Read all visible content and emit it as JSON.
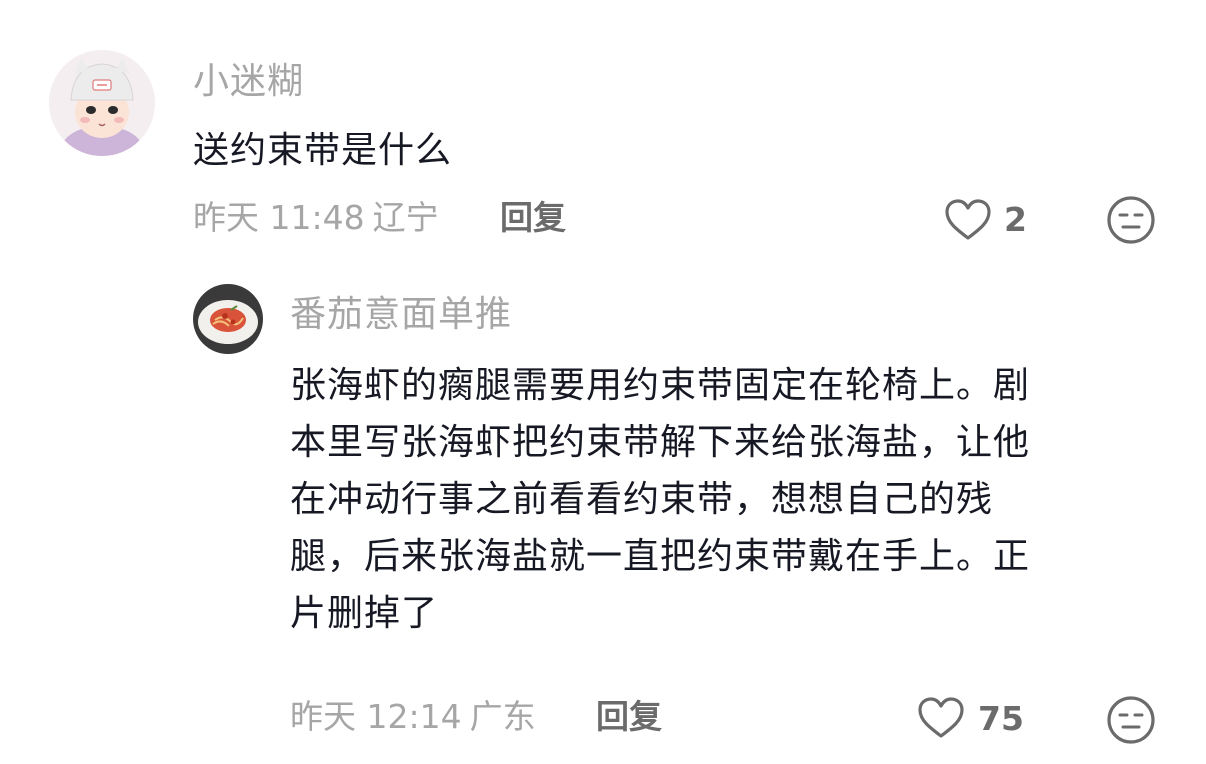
{
  "comments": [
    {
      "username": "小迷糊",
      "text": "送约束带是什么",
      "time": "昨天 11:48",
      "location": "辽宁",
      "reply_label": "回复",
      "likes": "2",
      "like_icon": "heart-outline-icon",
      "dislike_icon": "meh-face-icon"
    },
    {
      "username": "番茄意面单推",
      "text_lines": [
        "张海虾的瘸腿需要用约束带固定在轮椅上。剧",
        "本里写张海虾把约束带解下来给张海盐，让他",
        "在冲动行事之前看看约束带，想想自己的残",
        "腿，后来张海盐就一直把约束带戴在手上。正",
        "片删掉了"
      ],
      "time": "昨天 12:14",
      "location": "广东",
      "reply_label": "回复",
      "likes": "75",
      "like_icon": "heart-outline-icon",
      "dislike_icon": "meh-face-icon"
    }
  ]
}
